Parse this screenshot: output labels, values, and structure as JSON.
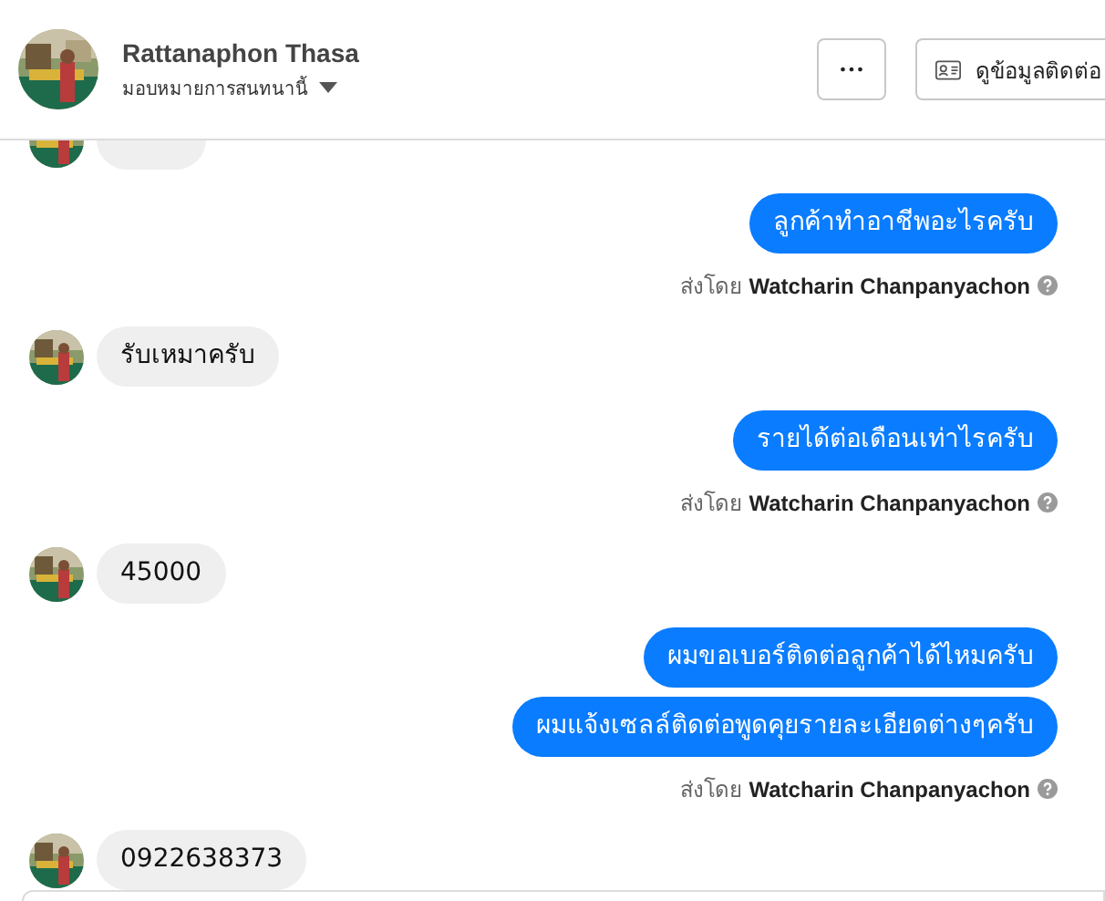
{
  "header": {
    "name": "Rattanaphon Thasa",
    "subtitle": "มอบหมายการสนทนานี้",
    "more_button": "•••",
    "contact_button": "ดูข้อมูลติดต่อ"
  },
  "messages": [
    {
      "kind": "received"
    },
    {
      "kind": "sent",
      "bubbles": [
        "ลูกค้าทำอาชีพอะไรครับ"
      ],
      "sent_by": "ส่งโดย",
      "sender": "Watcharin Chanpanyachon"
    },
    {
      "kind": "received",
      "text": "รับเหมาครับ"
    },
    {
      "kind": "sent",
      "bubbles": [
        "รายได้ต่อเดือนเท่าไรครับ"
      ],
      "sent_by": "ส่งโดย",
      "sender": "Watcharin Chanpanyachon"
    },
    {
      "kind": "received",
      "text": "45000"
    },
    {
      "kind": "sent",
      "bubbles": [
        "ผมขอเบอร์ติดต่อลูกค้าได้ไหมครับ",
        "ผมแจ้งเซลล์ติดต่อพูดคุยรายละเอียดต่างๆครับ"
      ],
      "sent_by": "ส่งโดย",
      "sender": "Watcharin Chanpanyachon"
    },
    {
      "kind": "received",
      "text": "0922638373"
    }
  ]
}
